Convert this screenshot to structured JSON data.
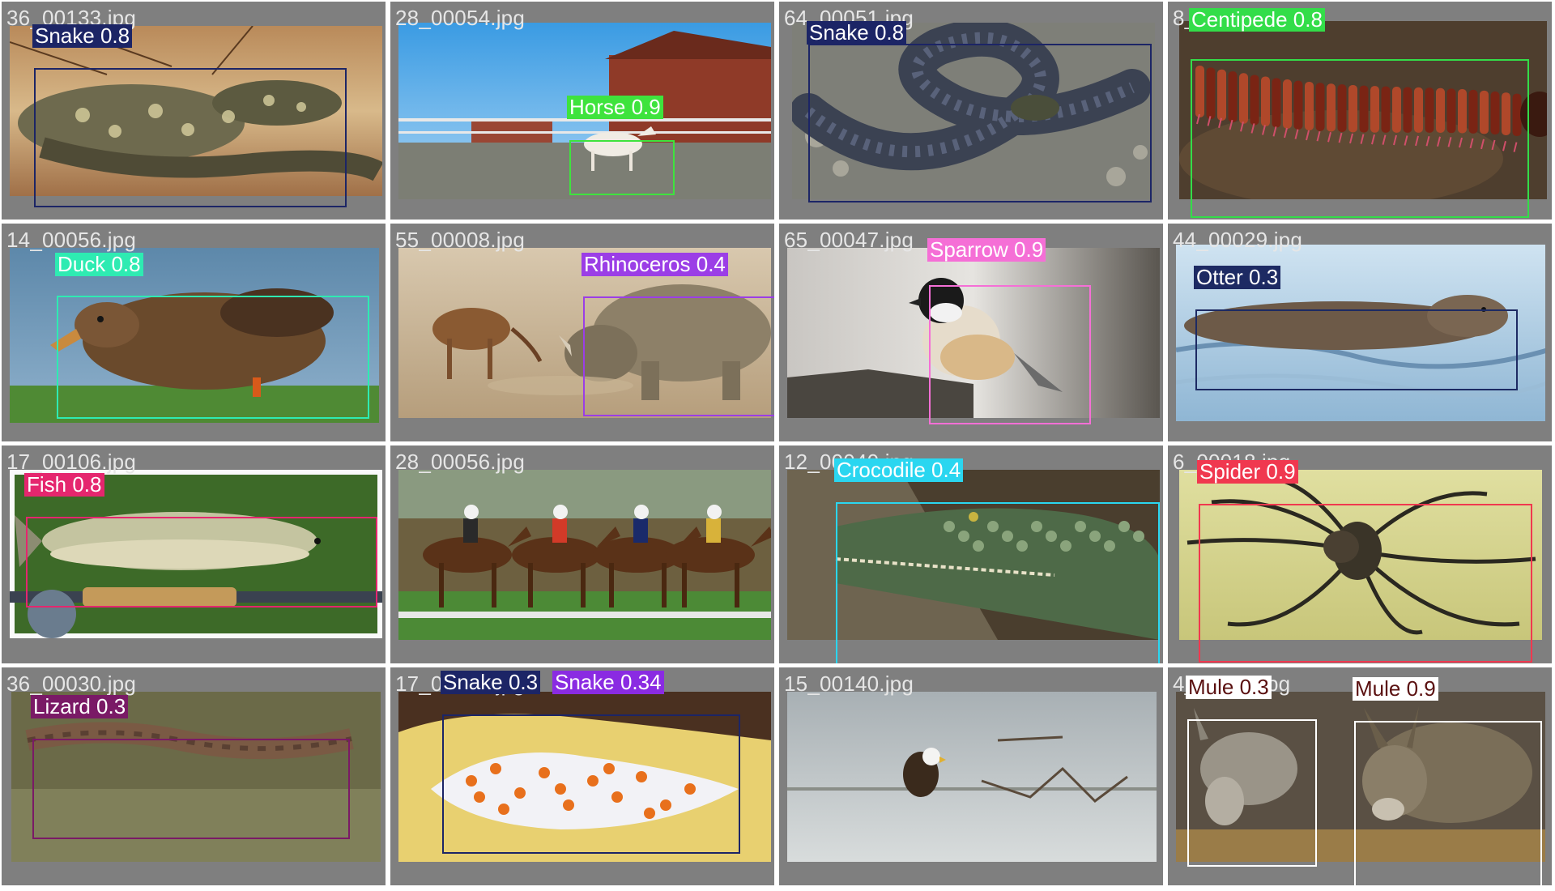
{
  "tiles": [
    {
      "filename": "36_00133.jpg",
      "photo": "lizard-on-rock",
      "detections": [
        {
          "label": "Snake 0.8",
          "color": "#1c2566"
        }
      ]
    },
    {
      "filename": "28_00054.jpg",
      "photo": "horse-at-barn",
      "detections": [
        {
          "label": "Horse 0.9",
          "color": "#3ee33d"
        }
      ]
    },
    {
      "filename": "64_00051.jpg",
      "photo": "coiled-snake",
      "detections": [
        {
          "label": "Snake 0.8",
          "color": "#1c2566"
        }
      ]
    },
    {
      "filename": "8_00019.jpg",
      "photo": "millipede",
      "detections": [
        {
          "label": "Centipede 0.8",
          "color": "#33dd49"
        }
      ]
    },
    {
      "filename": "14_00056.jpg",
      "photo": "duck-on-grass",
      "detections": [
        {
          "label": "Duck 0.8",
          "color": "#2eebb2"
        }
      ]
    },
    {
      "filename": "55_00008.jpg",
      "photo": "rhino-and-antelope",
      "detections": [
        {
          "label": "Rhinoceros 0.4",
          "color": "#9b3ee6"
        }
      ]
    },
    {
      "filename": "65_00047.jpg",
      "photo": "chickadee-on-log",
      "detections": [
        {
          "label": "Sparrow 0.9",
          "color": "#f56fd6"
        }
      ]
    },
    {
      "filename": "44_00029.jpg",
      "photo": "otter-swimming",
      "detections": [
        {
          "label": "Otter 0.3",
          "color": "#1d2a63"
        }
      ]
    },
    {
      "filename": "17_00106.jpg",
      "photo": "trout-and-rod",
      "detections": [
        {
          "label": "Fish 0.8",
          "color": "#e5266e"
        }
      ]
    },
    {
      "filename": "28_00056.jpg",
      "photo": "horse-race",
      "detections": []
    },
    {
      "filename": "12_00040.jpg",
      "photo": "crocodile-head",
      "detections": [
        {
          "label": "Crocodile 0.4",
          "color": "#2ad6f0"
        }
      ]
    },
    {
      "filename": "6_00018.jpg",
      "photo": "spider",
      "detections": [
        {
          "label": "Spider 0.9",
          "color": "#f0384f"
        }
      ]
    },
    {
      "filename": "36_00030.jpg",
      "photo": "camouflaged-lizard",
      "detections": [
        {
          "label": "Lizard 0.3",
          "color": "#7a1a66"
        }
      ]
    },
    {
      "filename": "17_00087.jpg",
      "photo": "sea-slug",
      "detections": [
        {
          "label": "Snake 0.3",
          "color": "#1c2566"
        },
        {
          "label": "Snake 0.34",
          "color": "#8a2be2"
        }
      ]
    },
    {
      "filename": "15_00140.jpg",
      "photo": "eagle-in-water",
      "detections": []
    },
    {
      "filename": "4_00022.jpg",
      "photo": "two-donkeys",
      "detections": [
        {
          "label": "Mule 0.3",
          "color": "#ffffff"
        },
        {
          "label": "Mule 0.9",
          "color": "#ffffff"
        }
      ]
    }
  ]
}
